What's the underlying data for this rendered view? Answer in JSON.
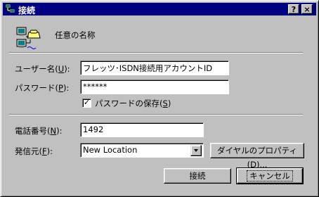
{
  "window": {
    "title": "接続",
    "help_label": "?",
    "close_label": "×"
  },
  "connection": {
    "name": "任意の名称"
  },
  "form": {
    "username_label": "ユーザー名(",
    "username_key": "U",
    "username_label_end": "):",
    "username_value": "フレッツ･ISDN接続用アカウントID",
    "password_label": "パスワード(",
    "password_key": "P",
    "password_label_end": "):",
    "password_value": "******",
    "save_password_label": "パスワードの保存(",
    "save_password_key": "S",
    "save_password_end": ")",
    "save_password_checked": "✓",
    "phone_label": "電話番号(",
    "phone_key": "N",
    "phone_label_end": "):",
    "phone_value": "1492",
    "dialfrom_label": "発信元(",
    "dialfrom_key": "F",
    "dialfrom_label_end": "):",
    "dialfrom_value": "New Location",
    "dial_properties_label": "ダイヤルのプロパティ(",
    "dial_properties_key": "D",
    "dial_properties_end": ")..."
  },
  "buttons": {
    "connect": "接続",
    "cancel": "キャンセル"
  },
  "icons": {
    "app": "network-computers-icon",
    "connection": "dialup-connection-icon",
    "dropdown": "dropdown-arrow-icon"
  }
}
